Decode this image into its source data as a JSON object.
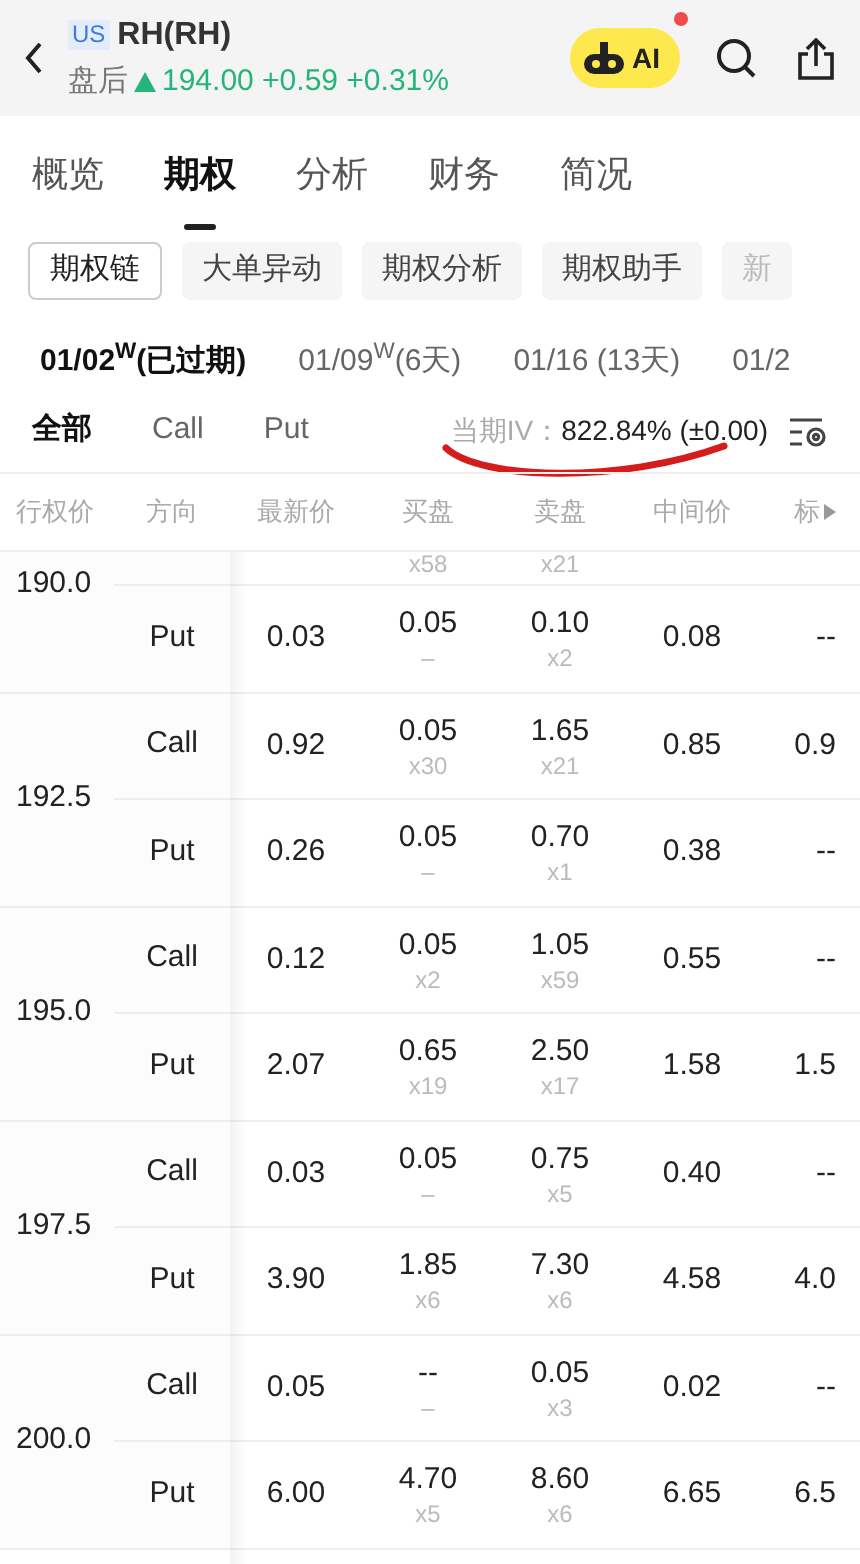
{
  "header": {
    "market": "US",
    "title": "RH(RH)",
    "session": "盘后",
    "price": "194.00",
    "change": "+0.59",
    "change_pct": "+0.31%",
    "ai_label": "AI",
    "ai_notification": true
  },
  "tabs": [
    {
      "label": "概览",
      "selected": false
    },
    {
      "label": "期权",
      "selected": true
    },
    {
      "label": "分析",
      "selected": false
    },
    {
      "label": "财务",
      "selected": false
    },
    {
      "label": "简况",
      "selected": false
    }
  ],
  "chips": [
    {
      "label": "期权链",
      "selected": true
    },
    {
      "label": "大单异动",
      "selected": false
    },
    {
      "label": "期权分析",
      "selected": false
    },
    {
      "label": "期权助手",
      "selected": false
    },
    {
      "label": "新",
      "selected": false
    }
  ],
  "expiries": [
    {
      "label": "01/02$^{W}$(已过期)",
      "selected": true
    },
    {
      "label": "01/09$^{W}$(6天)",
      "selected": false
    },
    {
      "label": "01/16 (13天)",
      "selected": false
    },
    {
      "label": "01/2",
      "selected": false
    }
  ],
  "filters": [
    {
      "label": "全部",
      "selected": true
    },
    {
      "label": "Call",
      "selected": false
    },
    {
      "label": "Put",
      "selected": false
    }
  ],
  "iv": {
    "label": "当期IV：",
    "value": "822.84% (±0.00)"
  },
  "table": {
    "columns": [
      "行权价",
      "方向",
      "最新价",
      "买盘",
      "卖盘",
      "中间价",
      "标"
    ],
    "groups": [
      {
        "strike": "190.0",
        "rows": [
          {
            "bid_size": "x58",
            "ask_size": "x21"
          },
          {
            "type": "Put",
            "last": "0.03",
            "bid": "0.05",
            "bid_size": "–",
            "ask": "0.10",
            "ask_size": "x2",
            "mid": "0.08",
            "mark": "--"
          }
        ]
      },
      {
        "strike": "192.5",
        "rows": [
          {
            "type": "Call",
            "last": "0.92",
            "bid": "0.05",
            "bid_size": "x30",
            "ask": "1.65",
            "ask_size": "x21",
            "mid": "0.85",
            "mark": "0.9"
          },
          {
            "type": "Put",
            "last": "0.26",
            "bid": "0.05",
            "bid_size": "–",
            "ask": "0.70",
            "ask_size": "x1",
            "mid": "0.38",
            "mark": "--"
          }
        ]
      },
      {
        "strike": "195.0",
        "rows": [
          {
            "type": "Call",
            "last": "0.12",
            "bid": "0.05",
            "bid_size": "x2",
            "ask": "1.05",
            "ask_size": "x59",
            "mid": "0.55",
            "mark": "--"
          },
          {
            "type": "Put",
            "last": "2.07",
            "bid": "0.65",
            "bid_size": "x19",
            "ask": "2.50",
            "ask_size": "x17",
            "mid": "1.58",
            "mark": "1.5"
          }
        ]
      },
      {
        "strike": "197.5",
        "rows": [
          {
            "type": "Call",
            "last": "0.03",
            "bid": "0.05",
            "bid_size": "–",
            "ask": "0.75",
            "ask_size": "x5",
            "mid": "0.40",
            "mark": "--"
          },
          {
            "type": "Put",
            "last": "3.90",
            "bid": "1.85",
            "bid_size": "x6",
            "ask": "7.30",
            "ask_size": "x6",
            "mid": "4.58",
            "mark": "4.0"
          }
        ]
      },
      {
        "strike": "200.0",
        "rows": [
          {
            "type": "Call",
            "last": "0.05",
            "bid": "--",
            "bid_size": "–",
            "ask": "0.05",
            "ask_size": "x3",
            "mid": "0.02",
            "mark": "--"
          },
          {
            "type": "Put",
            "last": "6.00",
            "bid": "4.70",
            "bid_size": "x5",
            "ask": "8.60",
            "ask_size": "x6",
            "mid": "6.65",
            "mark": "6.5"
          }
        ]
      }
    ]
  }
}
